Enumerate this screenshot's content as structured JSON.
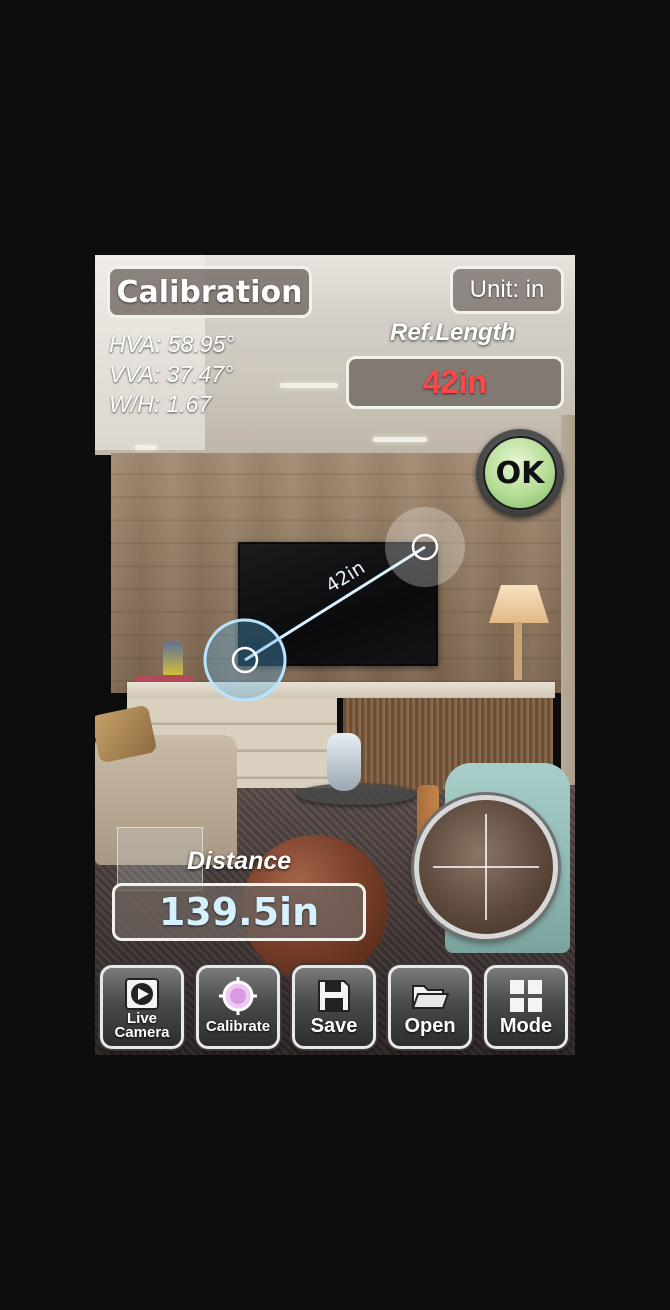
{
  "header": {
    "title": "Calibration",
    "unit_label": "Unit: in"
  },
  "camera_info": {
    "hva": "HVA: 58.95°",
    "vva": "VVA: 37.47°",
    "wh": "W/H: 1.67"
  },
  "reference": {
    "label": "Ref.Length",
    "value": "42in",
    "value_color": "#ff4747"
  },
  "ok_button": {
    "label": "OK"
  },
  "measure_line": {
    "label": "42in"
  },
  "distance": {
    "label": "Distance",
    "value": "139.5in",
    "value_color": "#d6f1ff"
  },
  "toolbar": {
    "buttons": [
      {
        "label_line1": "Live",
        "label_line2": "Camera",
        "icon": "play-icon"
      },
      {
        "label": "Calibrate",
        "icon": "target-icon"
      },
      {
        "label": "Save",
        "icon": "floppy-disk-icon"
      },
      {
        "label": "Open",
        "icon": "folder-icon"
      },
      {
        "label": "Mode",
        "icon": "grid-icon"
      }
    ]
  }
}
